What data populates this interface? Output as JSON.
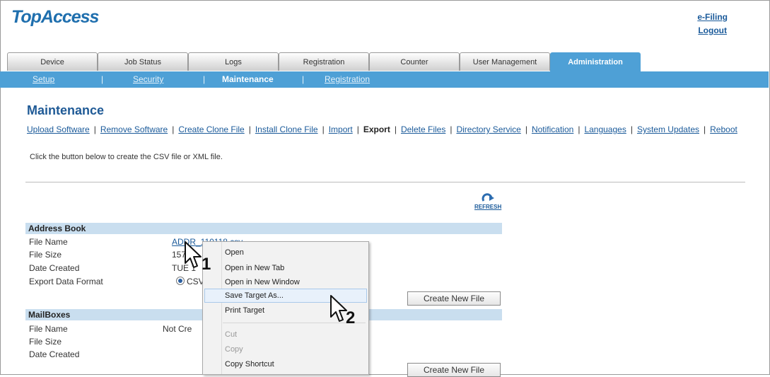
{
  "header": {
    "logo": "TopAccess",
    "links": [
      "e-Filing",
      "Logout"
    ]
  },
  "tabs": [
    "Device",
    "Job Status",
    "Logs",
    "Registration",
    "Counter",
    "User Management",
    "Administration"
  ],
  "active_tab": "Administration",
  "subnav": {
    "items": [
      "Setup",
      "Security",
      "Maintenance",
      "Registration"
    ],
    "active": "Maintenance",
    "separator": "|"
  },
  "page": {
    "title": "Maintenance",
    "submenu": [
      "Upload Software",
      "Remove Software",
      "Create Clone File",
      "Install Clone File",
      "Import",
      "Export",
      "Delete Files",
      "Directory Service",
      "Notification",
      "Languages",
      "System Updates",
      "Reboot"
    ],
    "submenu_active": "Export",
    "description": "Click the button below to create the CSV file or XML file.",
    "refresh_label": "REFRESH"
  },
  "address_book": {
    "heading": "Address Book",
    "labels": [
      "File Name",
      "File Size",
      "Date Created",
      "Export Data Format"
    ],
    "file_name": "ADDR_110118.csv",
    "file_size": "157",
    "date_created": "TUE 1",
    "format_selected": "CSV",
    "button": "Create New File"
  },
  "mailboxes": {
    "heading": "MailBoxes",
    "labels": [
      "File Name",
      "File Size",
      "Date Created"
    ],
    "file_name": "Not Cre",
    "button": "Create New File"
  },
  "context_menu": {
    "items": [
      "Open",
      "Open in New Tab",
      "Open in New Window",
      "Save Target As...",
      "Print Target",
      "Cut",
      "Copy",
      "Copy Shortcut"
    ],
    "highlighted": "Save Target As...",
    "disabled": [
      "Cut",
      "Copy"
    ]
  },
  "steps": [
    "1",
    "2"
  ],
  "colors": {
    "tab_active": "#4ea0d6",
    "subbar": "#4ea0d6",
    "section_header": "#c9deef",
    "link": "#1a5a9a",
    "title": "#1f5a96"
  }
}
